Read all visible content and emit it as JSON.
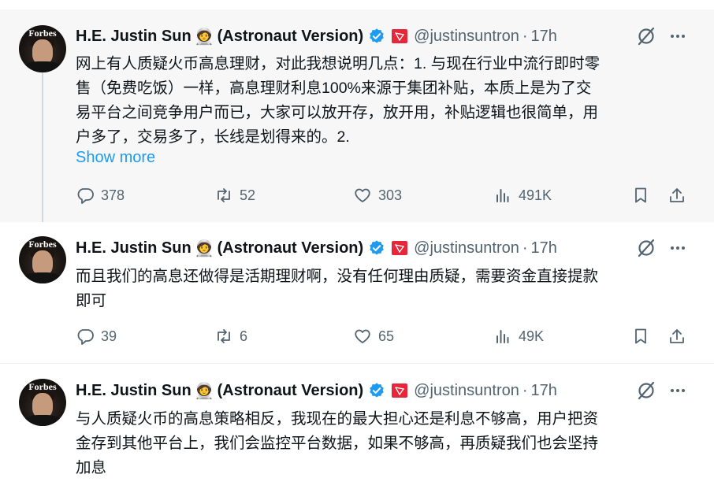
{
  "author": {
    "name": "H.E. Justin Sun",
    "emoji": "🧑‍🚀",
    "suffix": "(Astronaut Version)",
    "handle": "@justinsuntron",
    "avatar_brand": "Forbes"
  },
  "colors": {
    "accent": "#1d9bf0",
    "verified": "#1d9bf0",
    "flag": "#e7263a",
    "muted": "#536471"
  },
  "tweets": [
    {
      "time": "17h",
      "lines": [
        "网上有人质疑火币高息理财，对此我想说明几点：1. 与现在行业中流行即时零",
        "售（免费吃饭）一样，高息理财利息100%来源于集团补贴，本质上是为了交",
        "易平台之间竞争用户而已，大家可以放开存，放开用，补贴逻辑也很简单，用",
        "户多了，交易多了，长线是划得来的。2."
      ],
      "show_more": "Show more",
      "replies": "378",
      "retweets": "52",
      "likes": "303",
      "views": "491K"
    },
    {
      "time": "17h",
      "lines": [
        "而且我们的高息还做得是活期理财啊，没有任何理由质疑，需要资金直接提款",
        "即可"
      ],
      "replies": "39",
      "retweets": "6",
      "likes": "65",
      "views": "49K"
    },
    {
      "time": "17h",
      "lines": [
        "与人质疑火币的高息策略相反，我现在的最大担心还是利息不够高，用户把资",
        "金存到其他平台上，我们会监控平台数据，如果不够高，再质疑我们也会坚持",
        "加息"
      ]
    }
  ],
  "sep": "·"
}
